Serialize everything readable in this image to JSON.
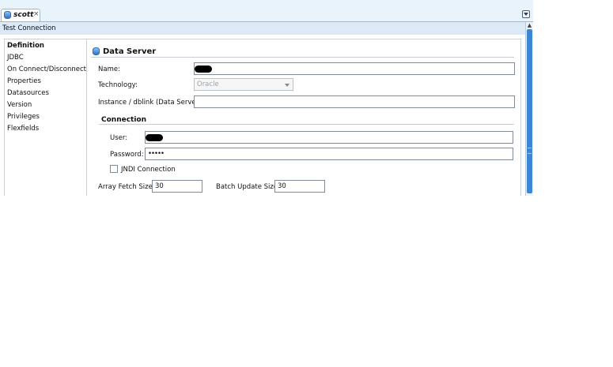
{
  "tab": {
    "title": "scott",
    "close": "×"
  },
  "toolbar": {
    "test_connection": "Test Connection"
  },
  "nav": {
    "items": [
      "Definition",
      "JDBC",
      "On Connect/Disconnect",
      "Properties",
      "Datasources",
      "Version",
      "Privileges",
      "Flexfields"
    ],
    "selected": "Definition"
  },
  "data_server": {
    "title": "Data Server",
    "name_label": "Name:",
    "technology_label": "Technology:",
    "technology_value": "Oracle",
    "instance_label": "Instance / dblink (Data Server):",
    "instance_value": ""
  },
  "connection": {
    "title": "Connection",
    "user_label": "User:",
    "password_label": "Password:",
    "password_value": "•••••",
    "jndi_label": "JNDI Connection",
    "jndi_checked": false
  },
  "fetch": {
    "array_label": "Array Fetch Size:",
    "array_value": "30",
    "batch_label": "Batch Update Size:",
    "batch_value": "30"
  },
  "colors": {
    "accent": "#3d86d6",
    "tabbar": "#e9f3fb",
    "toolbar": "#dce9f7"
  },
  "icons": {
    "tab": "database-icon",
    "section": "database-icon",
    "view_menu": "view-menu-icon"
  }
}
